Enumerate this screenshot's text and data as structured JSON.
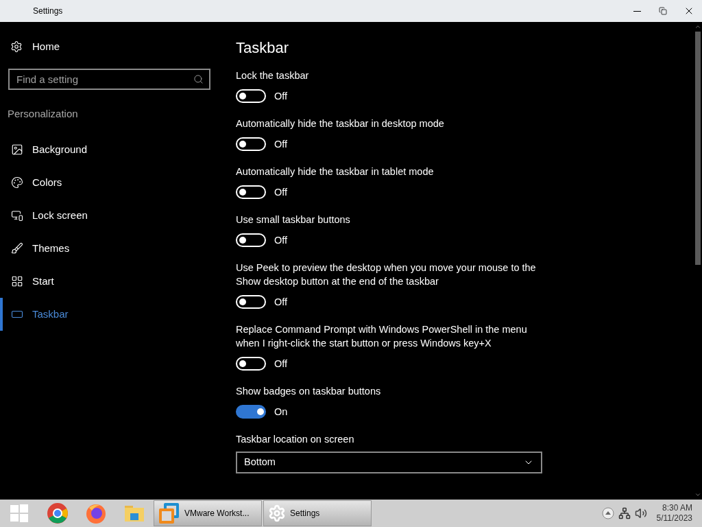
{
  "window": {
    "title": "Settings"
  },
  "sidebar": {
    "home": "Home",
    "search": {
      "placeholder": "Find a setting"
    },
    "section": "Personalization",
    "items": [
      {
        "label": "Background",
        "selected": false
      },
      {
        "label": "Colors",
        "selected": false
      },
      {
        "label": "Lock screen",
        "selected": false
      },
      {
        "label": "Themes",
        "selected": false
      },
      {
        "label": "Start",
        "selected": false
      },
      {
        "label": "Taskbar",
        "selected": true
      }
    ]
  },
  "main": {
    "title": "Taskbar",
    "settings": [
      {
        "kind": "toggle",
        "label": "Lock the taskbar",
        "on": false,
        "state": "Off"
      },
      {
        "kind": "toggle",
        "label": "Automatically hide the taskbar in desktop mode",
        "on": false,
        "state": "Off"
      },
      {
        "kind": "toggle",
        "label": "Automatically hide the taskbar in tablet mode",
        "on": false,
        "state": "Off"
      },
      {
        "kind": "toggle",
        "label": "Use small taskbar buttons",
        "on": false,
        "state": "Off"
      },
      {
        "kind": "toggle",
        "label": "Use Peek to preview the desktop when you move your mouse to the Show desktop button at the end of the taskbar",
        "on": false,
        "state": "Off"
      },
      {
        "kind": "toggle",
        "label": "Replace Command Prompt with Windows PowerShell in the menu when I right-click the start button or press Windows key+X",
        "on": false,
        "state": "Off"
      },
      {
        "kind": "toggle",
        "label": "Show badges on taskbar buttons",
        "on": true,
        "state": "On"
      },
      {
        "kind": "dropdown",
        "label": "Taskbar location on screen",
        "value": "Bottom"
      }
    ]
  },
  "taskbar": {
    "windows": [
      {
        "label": "VMware Workst..."
      },
      {
        "label": "Settings"
      }
    ],
    "clock": {
      "time": "8:30 AM",
      "date": "5/11/2023"
    }
  }
}
